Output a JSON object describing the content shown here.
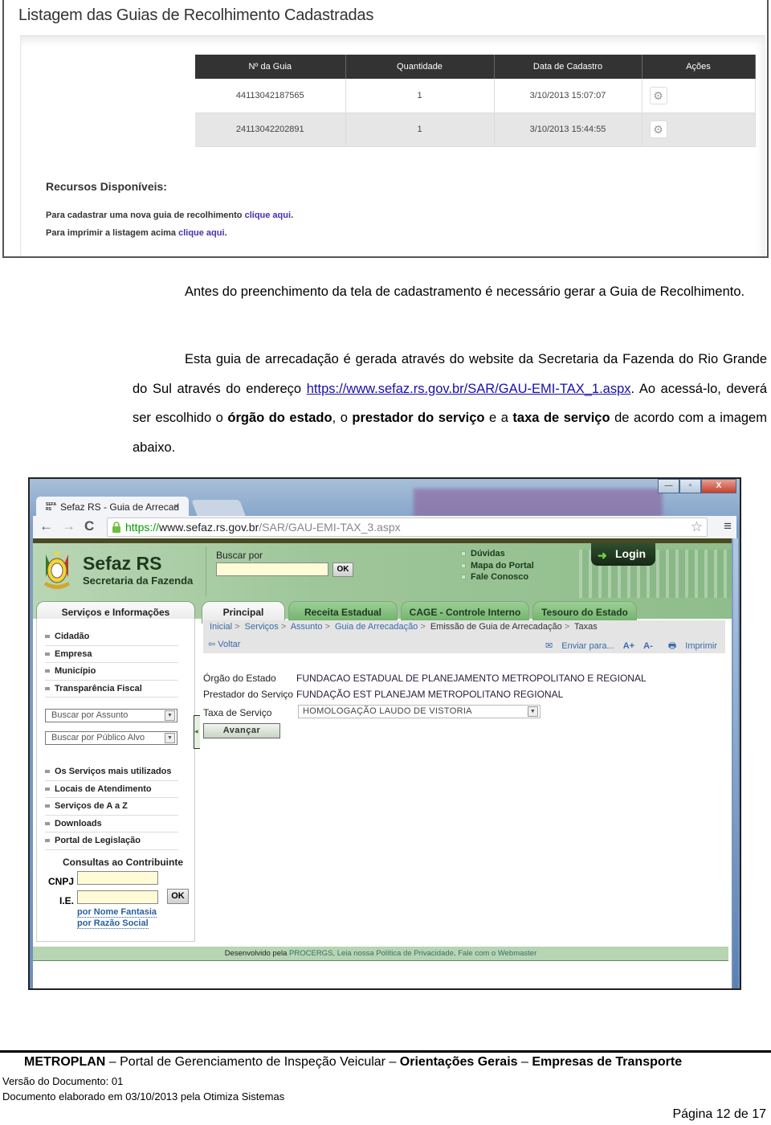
{
  "screenshot1": {
    "title": "Listagem das Guias de Recolhimento Cadastradas",
    "table": {
      "headers": [
        "Nº da Guia",
        "Quantidade",
        "Data de Cadastro",
        "Ações"
      ],
      "rows": [
        {
          "numero": "44113042187565",
          "quantidade": "1",
          "data": "3/10/2013 15:07:07",
          "action_icon": "gear-icon"
        },
        {
          "numero": "24113042202891",
          "quantidade": "1",
          "data": "3/10/2013 15:44:55",
          "action_icon": "gear-icon"
        }
      ]
    },
    "recursos": {
      "title": "Recursos Disponíveis:",
      "line1_text": "Para cadastrar uma nova guia de recolhimento ",
      "line1_link": "clique aqui",
      "line2_text": "Para imprimir a listagem acima ",
      "line2_link": "clique aqui",
      "period": "."
    }
  },
  "body_text": {
    "para1": "Antes do preenchimento da tela de cadastramento é necessário gerar a Guia de Recolhimento.",
    "para2_a": "Esta guia de arrecadação é gerada através do website da Secretaria da Fazenda do Rio Grande do Sul através do endereço ",
    "para2_link": "https://www.sefaz.rs.gov.br/SAR/GAU-EMI-TAX_1.aspx",
    "para2_b": ". Ao acessá-lo, deverá ser escolhido o ",
    "bold1": "órgão do estado",
    "para2_c": ", o ",
    "bold2": "prestador do serviço",
    "para2_d": " e a ",
    "bold3": "taxa de serviço",
    "para2_e": " de acordo com a imagem abaixo."
  },
  "browser": {
    "tab_title": "Sefaz RS - Guia de Arrecad",
    "favicon_text": "SEFA RS",
    "close_glyph": "×",
    "window_buttons": {
      "minimize": "—",
      "maximize": "▫",
      "close": "X"
    },
    "nav": {
      "back": "←",
      "forward": "→",
      "reload": "C"
    },
    "url_protocol": "https://",
    "url_host": "www.sefaz.rs.gov.br",
    "url_path": "/SAR/GAU-EMI-TAX_3.aspx",
    "star_glyph": "☆",
    "menu_glyph": "≡"
  },
  "site": {
    "brand": "Sefaz RS",
    "brand_sub": "Secretaria da Fazenda",
    "search_label": "Buscar por",
    "ok_label": "OK",
    "quicklinks": [
      "Dúvidas",
      "Mapa do Portal",
      "Fale Conosco"
    ],
    "login_label": "Login",
    "tabs": [
      "Serviços e Informações",
      "Principal",
      "Receita Estadual",
      "CAGE - Controle Interno",
      "Tesouro do Estado"
    ],
    "sidebar_menu1": [
      "Cidadão",
      "Empresa",
      "Município",
      "Transparência Fiscal"
    ],
    "select_assunto": "Buscar por Assunto",
    "select_publico": "Buscar por Público Alvo",
    "sidebar_menu2": [
      "Os Serviços mais utilizados",
      "Locais de Atendimento",
      "Serviços de A a Z",
      "Downloads",
      "Portal de Legislação"
    ],
    "consultas_title": "Consultas ao Contribuinte",
    "cnpj_label": "CNPJ",
    "ie_label": "I.E.",
    "ok2_label": "OK",
    "link_nome_fantasia": "por Nome Fantasia",
    "link_razao_social": "por Razão Social",
    "breadcrumb": [
      "Inicial",
      "Serviços",
      "Assunto",
      "Guia de Arrecadação",
      "Emissão de Guia de Arrecadação",
      "Taxas"
    ],
    "breadcrumb_sep": ">",
    "voltar": "Voltar",
    "enviar": "Enviar para...",
    "font_plus": "A+",
    "font_minus": "A-",
    "imprimir": "Imprimir",
    "form": {
      "orgao_label": "Órgão do Estado",
      "orgao_value": "FUNDACAO ESTADUAL DE PLANEJAMENTO METROPOLITANO E REGIONAL",
      "prestador_label": "Prestador do Serviço",
      "prestador_value": "FUNDAÇÃO EST PLANEJAM METROPOLITANO REGIONAL",
      "taxa_label": "Taxa de Serviço",
      "taxa_value": "HOMOLOGAÇÃO LAUDO DE VISTORIA",
      "avancar": "Avançar"
    },
    "footer": {
      "prefix": "Desenvolvido pela ",
      "procergs": "PROCERGS",
      "mid": ". ",
      "privacidade": "Leia nossa Política de Privacidade",
      "mid2": ". ",
      "webmaster": "Fale com o Webmaster"
    }
  },
  "page_footer": {
    "org": "METROPLAN",
    "dash": " – ",
    "portal": "Portal de Gerenciamento de Inspeção Veicular",
    "section": "Orientações Gerais",
    "subsection": "Empresas de Transporte",
    "version": "Versão do Documento: 01",
    "doc": "Documento elaborado em 03/10/2013 pela Otimiza Sistemas",
    "page": "Página 12 de 17"
  }
}
